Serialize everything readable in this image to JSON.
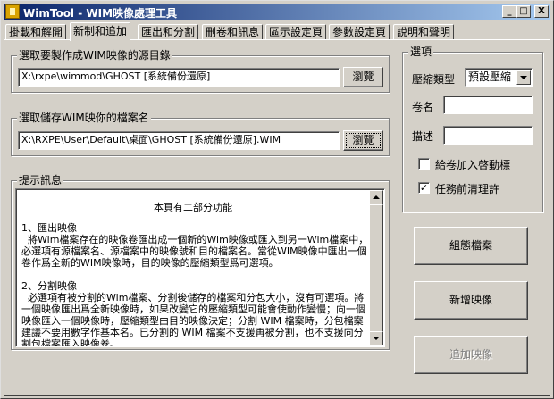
{
  "window": {
    "title": "WimTool - WIM映像處理工具"
  },
  "titlebar_buttons": {
    "minimize": "_",
    "maximize": "□",
    "close": "X"
  },
  "tabs": [
    "掛載和解開",
    "新制和追加",
    "匯出和分割",
    "刪卷和訊息",
    "區示設定頁",
    "參數設定頁",
    "說明和聲明"
  ],
  "active_tab_index": 1,
  "source": {
    "group_label": "選取要製作成WIM映像的源目錄",
    "path": "X:\\rxpe\\wimmod\\GHOST [系統備份還原]",
    "browse_label": "瀏覽"
  },
  "target": {
    "group_label": "選取儲存WIM映你的檔案名",
    "path": "X:\\RXPE\\User\\Default\\桌面\\GHOST [系統備份還原].WIM",
    "browse_label": "瀏覽"
  },
  "info": {
    "group_label": "提示訊息",
    "heading": "本頁有二部分功能",
    "body": "1、匯出映像\n  將Wim檔案存在的映像卷匯出成一個新的Wim映像或匯入到另一Wim檔案中，必選項有源檔案名、源檔案中的映像號和目的檔案名。當從WIM映像中匯出一個卷作爲全新的WIM映像時，目的映像的壓縮類型爲可選項。\n\n2、分割映像\n  必選項有被分割的Wim檔案、分割後儲存的檔案和分包大小，沒有可選項。將一個映像匯出爲全新映像時，如果改變它的壓縮類型可能會使動作變慢；向一個映像匯入一個映像時，壓縮類型由目的映像決定；分割 WIM 檔案時，分包檔案建議不要用數字作基本名。已分割的 WIM 檔案不支援再被分割，也不支援向分割包檔案匯入映像卷。"
  },
  "options": {
    "group_label": "選項",
    "compression_label": "壓縮類型",
    "compression_value": "預設壓縮",
    "volume_name_label": "卷名",
    "volume_name_value": "",
    "description_label": "描述",
    "description_value": "",
    "add_boot_label": "給卷加入啓動標",
    "add_boot_checked": false,
    "cleanup_label": "任務前清理許",
    "cleanup_checked": true
  },
  "actions": {
    "config_label": "組態檔案",
    "new_image_label": "新增映像",
    "append_image_label": "追加映像",
    "append_disabled": true
  }
}
